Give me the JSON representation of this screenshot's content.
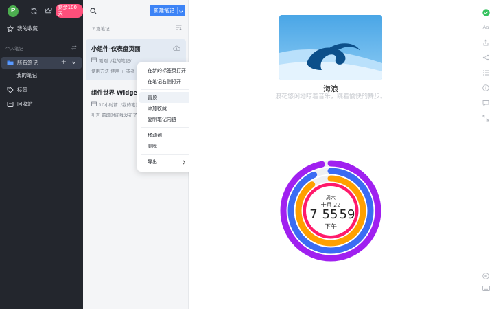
{
  "sidebar": {
    "avatar_letter": "P",
    "vip_badge": "剩余100天",
    "favorites": "我的收藏",
    "section_personal": "个人笔记",
    "all_notes": "所有笔记",
    "my_notes": "我的笔记",
    "tags": "标签",
    "trash": "回收站"
  },
  "list": {
    "new_note_button": "新建笔记",
    "count": "2 篇笔记",
    "notes": [
      {
        "title": "小组件-仪表盘页面",
        "time": "刚刚",
        "path": "/我的笔记/",
        "snippet": "使用方法 使用 + 或者 /"
      },
      {
        "title": "组件世界 Widget S",
        "time": "10小时前",
        "path": "/我的笔记/",
        "snippet": "引言 前段时间我发布了"
      }
    ]
  },
  "context_menu": {
    "items": [
      "在新的标签页打开",
      "在笔记右侧打开",
      "置顶",
      "添加收藏",
      "复制笔记内链",
      "移动到",
      "删除",
      "导出"
    ]
  },
  "widget_wave": {
    "title": "海浪",
    "desc": "浪花悠闲地哼着音乐，跳着愉快的舞步。"
  },
  "widget_clock": {
    "weekday": "周六",
    "date": "十月 22",
    "hour": "7",
    "minute": "55",
    "second": "59",
    "period": "下午",
    "rings": [
      {
        "color": "#a020f0",
        "fraction": 0.97
      },
      {
        "color": "#3b6cf3",
        "fraction": 0.93
      },
      {
        "color": "#ffa000",
        "fraction": 0.9
      },
      {
        "color": "#ff1a6b",
        "fraction": 0.98
      }
    ]
  },
  "colors": {
    "accent": "#3c83f6",
    "sidebar_bg": "#23262d",
    "badge": "#ff4f7b",
    "avatar": "#4cae4f",
    "status_green": "#35c25e"
  }
}
